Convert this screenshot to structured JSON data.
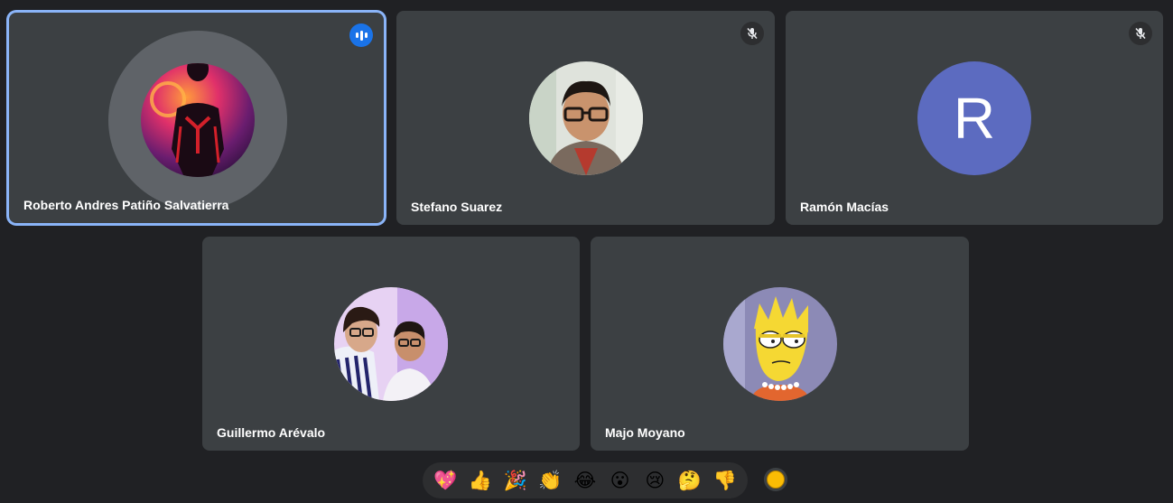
{
  "participants": [
    {
      "name": "Roberto Andres Patiño Salvatierra",
      "speaking": true,
      "avatar_icon": "spiderman-avatar-icon"
    },
    {
      "name": "Stefano Suarez",
      "muted": true,
      "avatar_icon": "person-photo-avatar-icon"
    },
    {
      "name": "Ramón Macías",
      "muted": true,
      "avatar_letter": "R",
      "avatar_color": "#5c6bc0"
    },
    {
      "name": "Guillermo Arévalo",
      "avatar_icon": "couple-photo-avatar-icon"
    },
    {
      "name": "Majo Moyano",
      "avatar_icon": "lisa-cartoon-avatar-icon"
    }
  ],
  "reactions": [
    "💖",
    "👍",
    "🎉",
    "👏",
    "😂",
    "😮",
    "😢",
    "🤔",
    "👎"
  ],
  "colors": {
    "background": "#202124",
    "tile": "#3c4043",
    "accent": "#8ab4f8",
    "speaking": "#1a73e8"
  }
}
